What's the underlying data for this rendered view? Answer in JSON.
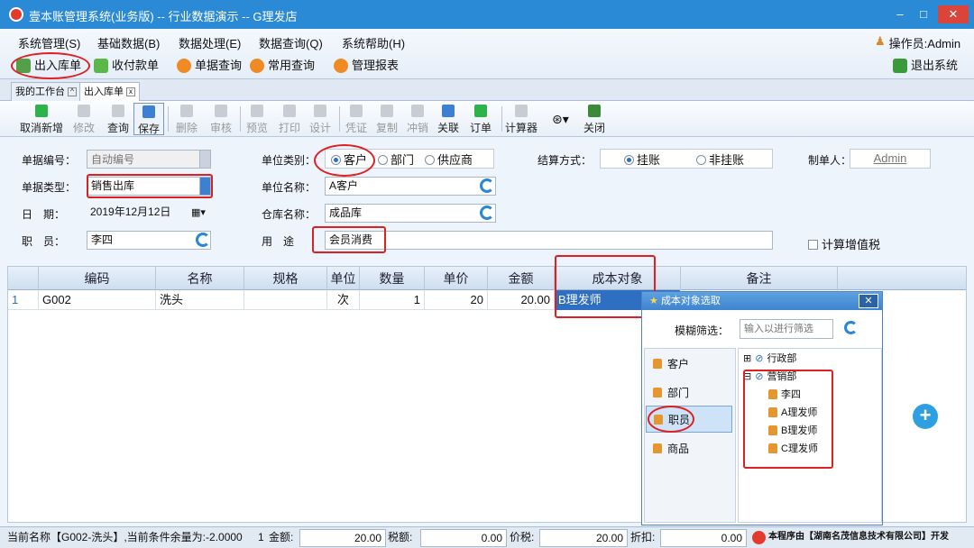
{
  "window": {
    "title": "壹本账管理系统(业务版) -- 行业数据演示 -- G理发店"
  },
  "menu": [
    "系统管理(S)",
    "基础数据(B)",
    "数据处理(E)",
    "数据查询(Q)",
    "系统帮助(H)"
  ],
  "operator": "操作员:Admin",
  "quickbar": {
    "stock_doc": "出入库单",
    "payment_doc": "收付款单",
    "doc_query": "单据查询",
    "common_query": "常用查询",
    "mgmt_report": "管理报表",
    "exit": "退出系统"
  },
  "tabs": {
    "workbench": "我的工作台",
    "stock_doc": "出入库单"
  },
  "toolbar": {
    "cancel_new": "取消新增",
    "edit": "修改",
    "query": "查询",
    "save": "保存",
    "delete": "删除",
    "audit": "审核",
    "preview": "预览",
    "print": "打印",
    "design": "设计",
    "voucher": "凭证",
    "copy": "复制",
    "reverse": "冲销",
    "link": "关联",
    "order": "订单",
    "calculator": "计算器",
    "close": "关闭"
  },
  "form": {
    "doc_no_label": "单据编号：",
    "doc_no_placeholder": "自动编号",
    "doc_type_label": "单据类型：",
    "doc_type_value": "销售出库",
    "date_label": "日　期：",
    "date_value": "2019年12月12日",
    "staff_label": "职　员：",
    "staff_value": "李四",
    "unit_cat_label": "单位类别：",
    "unit_cat_options": [
      "客户",
      "部门",
      "供应商"
    ],
    "unit_cat_selected": "客户",
    "unit_name_label": "单位名称：",
    "unit_name_value": "A客户",
    "warehouse_label": "仓库名称：",
    "warehouse_value": "成品库",
    "purpose_label": "用　途",
    "purpose_value": "会员消费",
    "settle_label": "结算方式：",
    "settle_options": [
      "挂账",
      "非挂账"
    ],
    "settle_selected": "挂账",
    "maker_label": "制单人：",
    "maker_value": "Admin",
    "vat_label": "计算增值税"
  },
  "grid": {
    "columns": [
      "编码",
      "名称",
      "规格",
      "单位",
      "数量",
      "单价",
      "金额",
      "成本对象",
      "备注"
    ],
    "rows": [
      {
        "idx": "1",
        "code": "G002",
        "name": "洗头",
        "spec": "",
        "unit": "次",
        "qty": "1",
        "price": "20",
        "amount": "20.00",
        "cost_obj": "B理发师",
        "note": ""
      }
    ]
  },
  "popup": {
    "title": "成本对象选取",
    "filter_label": "模糊筛选：",
    "filter_placeholder": "输入以进行筛选",
    "categories": [
      "客户",
      "部门",
      "职员",
      "商品"
    ],
    "selected_category": "职员",
    "tree": {
      "dept1": "行政部",
      "dept2": "营销部",
      "members": [
        "李四",
        "A理发师",
        "B理发师",
        "C理发师"
      ]
    }
  },
  "status": {
    "current": "当前名称【G002-洗头】,当前条件余量为:-2.0000",
    "count": "1",
    "amount_label": "金额:",
    "amount": "20.00",
    "tax_label": "税额:",
    "tax": "0.00",
    "pricetax_label": "价税:",
    "pricetax": "20.00",
    "discount_label": "折扣:",
    "discount": "0.00",
    "vendor": "本程序由【湖南名茂信息技术有限公司】开发"
  }
}
